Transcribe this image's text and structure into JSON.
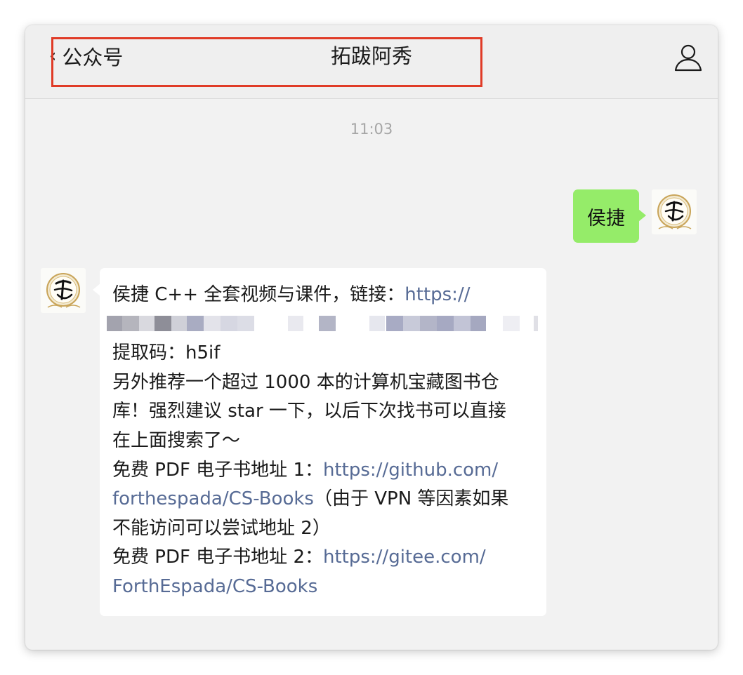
{
  "header": {
    "back_label": "公众号",
    "title": "拓跋阿秀"
  },
  "chat": {
    "timestamp": "11:03",
    "outgoing": {
      "text": "侯捷"
    },
    "incoming": {
      "line1_text": "侯捷 C++ 全套视频与课件，链接：",
      "line1_link": "https://",
      "line3": "提取码：h5if",
      "line4": "另外推荐一个超过 1000 本的计算机宝藏图书仓",
      "line5": "库！强烈建议 star 一下，以后下次找书可以直接",
      "line6": "在上面搜索了～",
      "line7_text": "免费 PDF 电子书地址 1：",
      "line7_link": "https://github.com/",
      "line8_link": "forthespada/CS-Books",
      "line8_text": "（由于 VPN 等因素如果",
      "line9": "不能访问可以尝试地址 2）",
      "line10_text": "免费 PDF 电子书地址 2：",
      "line10_link": "https://gitee.com/",
      "line11_link": "ForthEspada/CS-Books"
    }
  },
  "colors": {
    "outgoing_bubble": "#95ec69",
    "incoming_bubble": "#ffffff",
    "link": "#576b95",
    "highlight_border": "#e03b27",
    "window_bg": "#f2f2f2"
  },
  "icons": [
    "chevron-left-icon",
    "user-profile-icon",
    "avatar-seal-icon"
  ]
}
